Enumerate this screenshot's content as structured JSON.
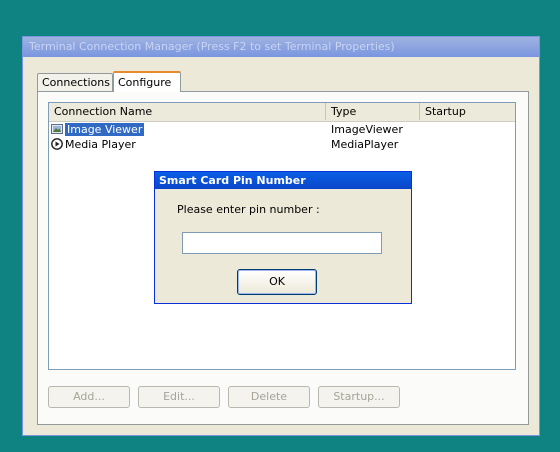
{
  "window": {
    "title": "Terminal Connection Manager (Press F2 to set Terminal Properties)"
  },
  "tabs": [
    {
      "label": "Connections"
    },
    {
      "label": "Configure"
    }
  ],
  "list": {
    "columns": [
      "Connection Name",
      "Type",
      "Startup"
    ],
    "rows": [
      {
        "name": "Image Viewer",
        "type": "ImageViewer",
        "startup": "",
        "icon": "image-viewer-icon"
      },
      {
        "name": "Media Player",
        "type": "MediaPlayer",
        "startup": "",
        "icon": "media-player-icon"
      }
    ]
  },
  "buttons": {
    "add": "Add...",
    "edit": "Edit...",
    "delete": "Delete",
    "startup": "Startup..."
  },
  "dialog": {
    "title": "Smart Card Pin Number",
    "prompt": "Please enter pin number :",
    "input_value": "",
    "ok": "OK"
  },
  "colors": {
    "desktop": "#0f8282",
    "dialog_title": "#0b46c9",
    "selection": "#316ac5"
  }
}
